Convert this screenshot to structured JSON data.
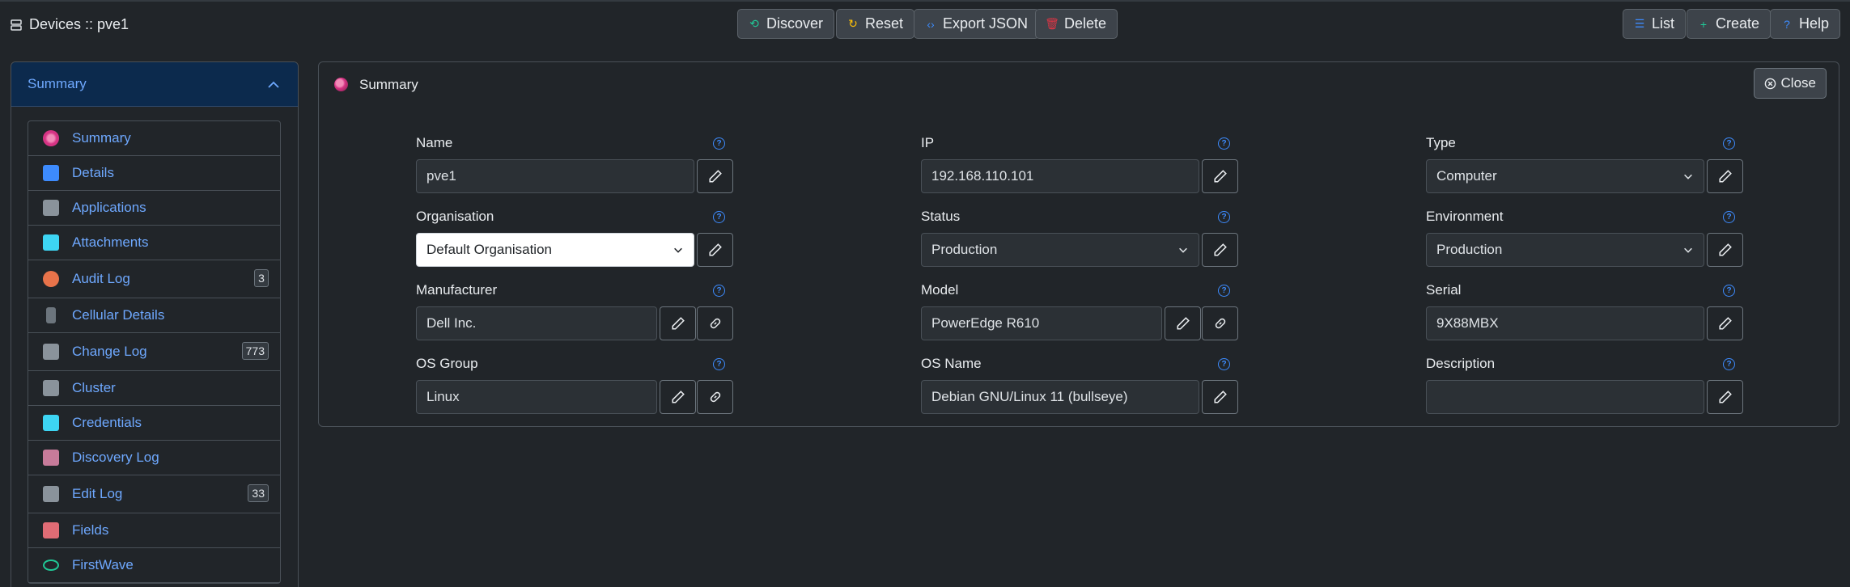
{
  "header": {
    "title": "Devices :: pve1",
    "buttons": {
      "discover": "Discover",
      "reset": "Reset",
      "export_json": "Export JSON",
      "delete": "Delete",
      "list": "List",
      "create": "Create",
      "help": "Help"
    }
  },
  "sidebar": {
    "header": "Summary",
    "items": [
      {
        "label": "Summary",
        "icon": "summary-icon",
        "color": "#d63384"
      },
      {
        "label": "Details",
        "icon": "details-icon",
        "color": "#3d8bfd"
      },
      {
        "label": "Applications",
        "icon": "applications-icon",
        "color": "#8a939b"
      },
      {
        "label": "Attachments",
        "icon": "attachments-icon",
        "color": "#3dd5f3"
      },
      {
        "label": "Audit Log",
        "icon": "audit-log-icon",
        "color": "#e8734a",
        "badge": "3"
      },
      {
        "label": "Cellular Details",
        "icon": "phone-icon",
        "color": "#6c757d"
      },
      {
        "label": "Change Log",
        "icon": "change-log-icon",
        "color": "#8a939b",
        "badge": "773"
      },
      {
        "label": "Cluster",
        "icon": "cluster-icon",
        "color": "#8a939b"
      },
      {
        "label": "Credentials",
        "icon": "lock-icon",
        "color": "#3dd5f3"
      },
      {
        "label": "Discovery Log",
        "icon": "discovery-log-icon",
        "color": "#c77b9a"
      },
      {
        "label": "Edit Log",
        "icon": "edit-log-icon",
        "color": "#8a939b",
        "badge": "33"
      },
      {
        "label": "Fields",
        "icon": "fields-icon",
        "color": "#e06c75"
      },
      {
        "label": "FirstWave",
        "icon": "firstwave-icon",
        "color": "#20c997"
      }
    ]
  },
  "panel": {
    "title": "Summary",
    "close_label": "Close",
    "fields": {
      "name": {
        "label": "Name",
        "value": "pve1"
      },
      "ip": {
        "label": "IP",
        "value": "192.168.110.101"
      },
      "type": {
        "label": "Type",
        "value": "Computer"
      },
      "organisation": {
        "label": "Organisation",
        "value": "Default Organisation"
      },
      "status": {
        "label": "Status",
        "value": "Production"
      },
      "environment": {
        "label": "Environment",
        "value": "Production"
      },
      "manufacturer": {
        "label": "Manufacturer",
        "value": "Dell Inc."
      },
      "model": {
        "label": "Model",
        "value": "PowerEdge R610"
      },
      "serial": {
        "label": "Serial",
        "value": "9X88MBX"
      },
      "os_group": {
        "label": "OS Group",
        "value": "Linux"
      },
      "os_name": {
        "label": "OS Name",
        "value": "Debian GNU/Linux 11 (bullseye)"
      },
      "description": {
        "label": "Description",
        "value": ""
      }
    }
  },
  "colors": {
    "accent": "#6ea8fe",
    "background": "#212529",
    "sidebar_header_bg": "#0c2a4d"
  }
}
